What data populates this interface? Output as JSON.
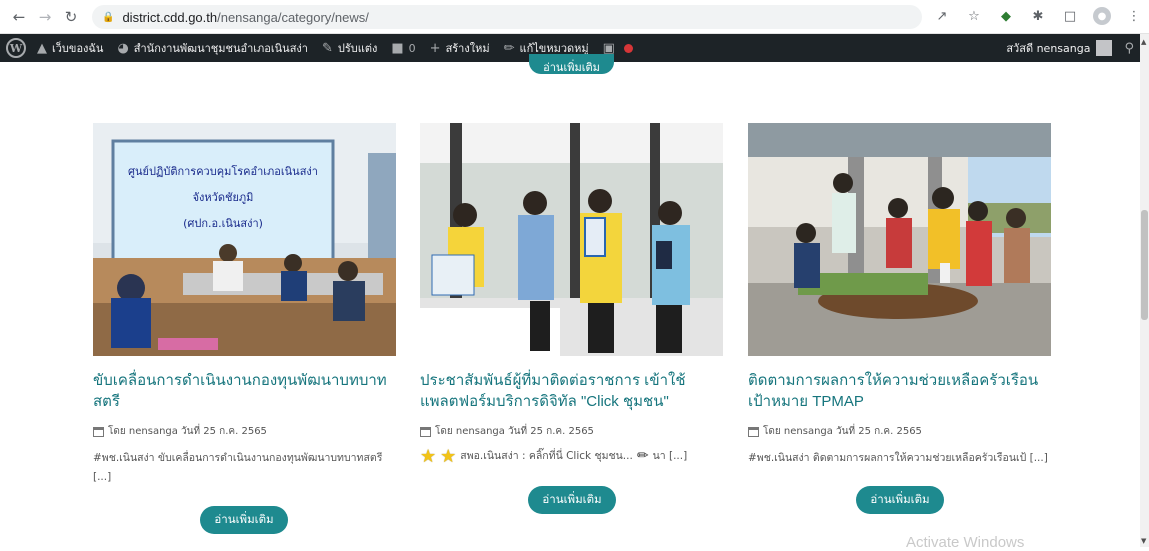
{
  "browser": {
    "url_host": "district.cdd.go.th",
    "url_path": "/nensanga/category/news/"
  },
  "adminbar": {
    "my_sites": "เว็บของฉัน",
    "site_name": "สำนักงานพัฒนาชุมชนอำเภอเนินสง่า",
    "customize": "ปรับแต่ง",
    "comments_count": "0",
    "new": "สร้างใหม่",
    "edit_category": "แก้ไขหมวดหมู่",
    "greeting": "สวัสดี nensanga"
  },
  "prev_card": {
    "read_more": "อ่านเพิ่มเติม"
  },
  "cards": [
    {
      "title": "ขับเคลื่อนการดำเนินงานกองทุนพัฒนาบทบาทสตรี",
      "meta": "โดย nensanga วันที่ 25 ก.ค. 2565",
      "excerpt": "#พช.เนินสง่า ขับเคลื่อนการดำเนินงานกองทุนพัฒนาบทบาทสตรี [...]",
      "read_more": "อ่านเพิ่มเติม",
      "sign_line1": "ศูนย์ปฏิบัติการควบคุมโรคอำเภอเนินสง่า",
      "sign_line2": "จังหวัดชัยภูมิ",
      "sign_line3": "(ศปก.อ.เนินสง่า)"
    },
    {
      "title": "ประชาสัมพันธ์ผู้ที่มาติดต่อราชการ เข้าใช้แพลตฟอร์มบริการดิจิทัล \"Click ชุมชน\"",
      "meta": "โดย nensanga วันที่ 25 ก.ค. 2565",
      "excerpt": "สพอ.เนินสง่า : คลิ๊กที่นี่ Click ชุมชน...",
      "excerpt_tail": "นา [...]",
      "read_more": "อ่านเพิ่มเติม"
    },
    {
      "title": "ติดตามการผลการให้ความช่วยเหลือครัวเรือนเป้าหมาย TPMAP",
      "meta": "โดย nensanga วันที่ 25 ก.ค. 2565",
      "excerpt": "#พช.เนินสง่า ติดตามการผลการให้ความช่วยเหลือครัวเรือนเป้ [...]",
      "read_more": "อ่านเพิ่มเติม"
    }
  ],
  "watermark": "Activate Windows",
  "colors": {
    "accent": "#1e8a8f",
    "title": "#16757d",
    "adminbar": "#1d2327"
  }
}
